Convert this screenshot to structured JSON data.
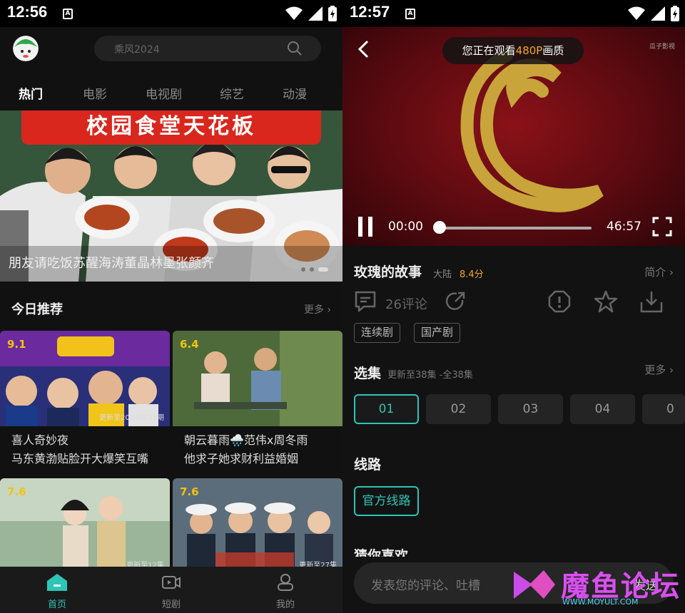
{
  "left": {
    "status": {
      "time": "12:56"
    },
    "search": {
      "placeholder": "乘风2024"
    },
    "tabs": [
      "热门",
      "电影",
      "电视剧",
      "综艺",
      "动漫"
    ],
    "banner": {
      "sign": "校园食堂天花板",
      "caption": "朋友请吃饭苏醒海涛董晶林墨张颜齐"
    },
    "today": {
      "title": "今日推荐",
      "more": "更多"
    },
    "cards": [
      {
        "score": "9.1",
        "ep": "更新至20240628期",
        "title1": "喜人奇妙夜",
        "title2": "马东黄渤贴脸开大爆笑互嘴"
      },
      {
        "score": "6.4",
        "ep": "",
        "title1": "朝云暮雨🌧️范伟x周冬雨",
        "title2": "他求子她求财利益婚姻"
      },
      {
        "score": "7.6",
        "ep": "更新至12集",
        "title1": "",
        "title2": ""
      },
      {
        "score": "7.6",
        "ep": "更新至27集",
        "title1": "",
        "title2": ""
      }
    ],
    "nav": [
      "首页",
      "短剧",
      "我的"
    ]
  },
  "right": {
    "status": {
      "time": "12:57"
    },
    "player": {
      "quality_prefix": "您正在观看",
      "quality": "480P",
      "quality_suffix": "画质",
      "watermark": "瓜子影视",
      "time_current": "00:00",
      "time_total": "46:57",
      "progress": 0
    },
    "info": {
      "title": "玫瑰的故事",
      "region": "大陆",
      "score": "8.4分",
      "intro": "简介",
      "comments": "26评论",
      "tags": [
        "连续剧",
        "国产剧"
      ]
    },
    "episodes": {
      "title": "选集",
      "subtitle": "更新至38集 -全38集",
      "more": "更多",
      "items": [
        "01",
        "02",
        "03",
        "04",
        "0"
      ]
    },
    "route": {
      "title": "线路",
      "item": "官方线路"
    },
    "guess": {
      "title": "猜你喜欢"
    },
    "comment": {
      "placeholder": "发表您的评论、吐槽",
      "send": "发送"
    }
  },
  "watermark": {
    "text": "魔鱼论坛",
    "url": "WWW.MOYULT.COM"
  },
  "colors": {
    "accent": "#2ec4b6",
    "score": "#f5a623",
    "banner_red": "#d9271e"
  }
}
